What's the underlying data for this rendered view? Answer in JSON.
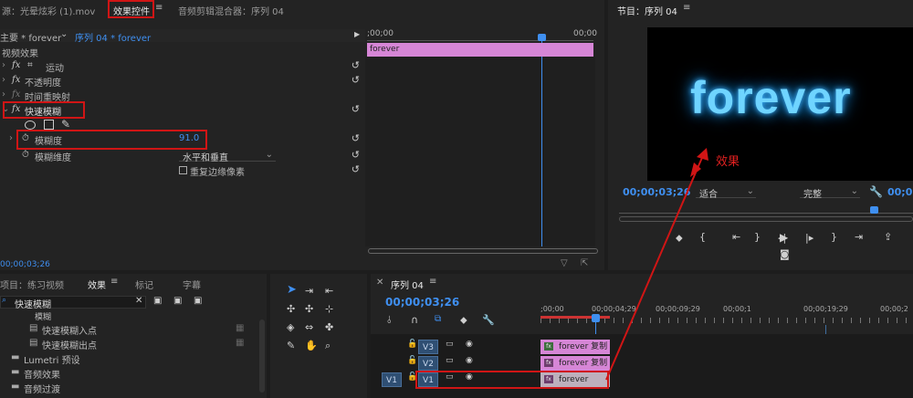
{
  "source_tab": "源：光晕炫彩 (1).mov",
  "effect_controls_tab": "效果控件",
  "mixer_tab": "音频剪辑混合器：序列 04",
  "master_clip": "主要 * forever",
  "seq_clip": "序列 04 * forever",
  "ec_time_start": ";00;00",
  "ec_time_end": "00;00",
  "ec_clip": "forever",
  "video_effects": "视频效果",
  "fx_label": "fx",
  "fx_motion": "运动",
  "fx_opacity": "不透明度",
  "fx_timeremap": "时间重映射",
  "fx_blur": "快速模糊",
  "blur_amount_label": "模糊度",
  "blur_amount_value": "91.0",
  "blur_dim_label": "模糊维度",
  "blur_dim_value": "水平和垂直",
  "repeat_edge": "重复边缘像素",
  "ec_timecode": "00;00;03;26",
  "program_title": "节目：序列 04",
  "preview_text": "forever",
  "annotation": "效果",
  "prog_timecode": "00;00;03;26",
  "fit": "适合",
  "full": "完整",
  "prog_timecode_end": "00;0",
  "project_tab": "项目：练习视频",
  "effects_tab": "效果",
  "markers_tab": "标记",
  "captions_tab": "字幕",
  "search_value": "快速模糊",
  "tree_folder": "模糊",
  "tree_item1": "快速模糊入点",
  "tree_item2": "快速模糊出点",
  "tree_lumetri": "Lumetri 预设",
  "tree_audio_fx": "音频效果",
  "tree_audio_tr": "音频过渡",
  "seq_tab": "序列 04",
  "seq_timecode": "00;00;03;26",
  "ruler": [
    ";00;00",
    "00;00;04;29",
    "00;00;09;29",
    "00;00;1",
    "00;00;19;29",
    "00;00;2"
  ],
  "tracks": [
    "V3",
    "V2",
    "V1"
  ],
  "v1_src": "V1",
  "clip_v3": "forever 复制",
  "clip_v2": "forever 复制",
  "clip_v1": "forever",
  "colors": {
    "accent": "#3f8ff0",
    "clip": "#d686d6",
    "annot": "#d01515",
    "glow": "#6fd4ff"
  }
}
